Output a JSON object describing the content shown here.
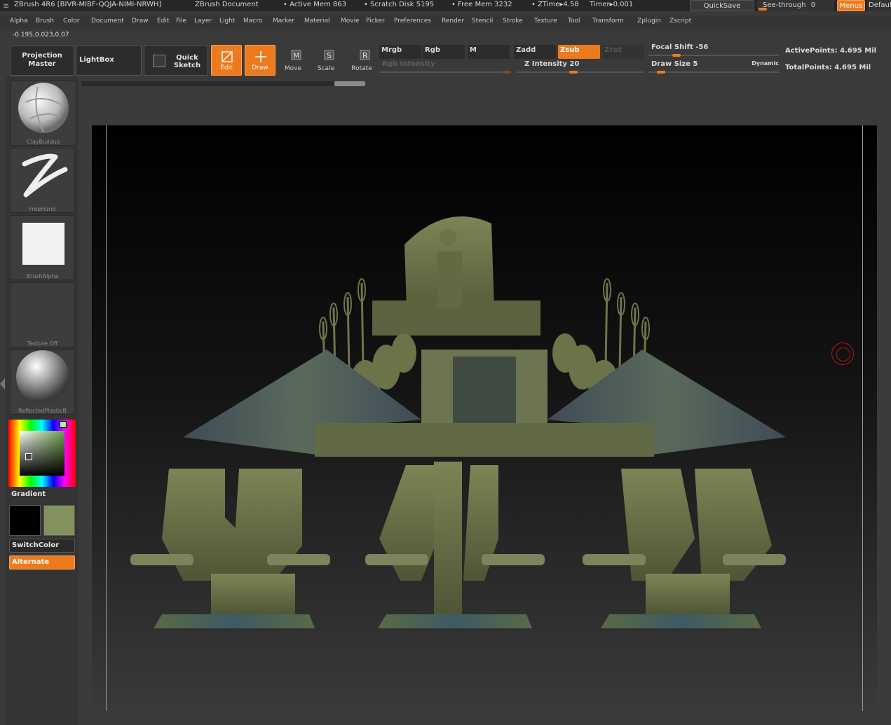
{
  "title_bar": {
    "app": "ZBrush 4R6 [BIVR-MIBF-QQJA-NIMI-NRWH]",
    "document": "ZBrush Document",
    "active_mem": "• Active Mem 863",
    "scratch_disk": "• Scratch Disk 5195",
    "free_mem": "• Free Mem 3232",
    "ztime": "• ZTime▸4.58",
    "timer": "Timer▸0.001",
    "quicksave": "QuickSave",
    "see_through": "See-through",
    "see_through_value": "0",
    "menus": "Menus",
    "default": "Default"
  },
  "menu": [
    "Alpha",
    "Brush",
    "Color",
    "Document",
    "Draw",
    "Edit",
    "File",
    "Layer",
    "Light",
    "Macro",
    "Marker",
    "Material",
    "Movie",
    "Picker",
    "Preferences",
    "Render",
    "Stencil",
    "Stroke",
    "Texture",
    "Tool",
    "Transform",
    "Zplugin",
    "Zscript"
  ],
  "coords": "-0.195,0.023,0.07",
  "toolbar": {
    "projection_master": "Projection Master",
    "lightbox": "LightBox",
    "quick_sketch": "Quick Sketch",
    "edit": "Edit",
    "draw": "Draw",
    "move": "Move",
    "scale": "Scale",
    "rotate": "Rotate",
    "mrgb": "Mrgb",
    "rgb": "Rgb",
    "m": "M",
    "zadd": "Zadd",
    "zsub": "Zsub",
    "zcut": "Zcut",
    "rgb_intensity": "Rgb Intensity",
    "z_intensity": "Z Intensity 20",
    "focal_shift": "Focal Shift -56",
    "draw_size": "Draw Size 5",
    "dynamic": "Dynamic",
    "active_points": "ActivePoints: 4.695 Mil",
    "total_points": "TotalPoints: 4.695 Mil"
  },
  "left_panel": {
    "brush": "ClayBuildup",
    "stroke": "FreeHand",
    "alpha": "BrushAlpha",
    "texture": "Texture Off",
    "material": "ReflectedPlasticB",
    "gradient": "Gradient",
    "switch_color": "SwitchColor",
    "alternate": "Alternate"
  },
  "colors": {
    "accent": "#ed7b1d",
    "main_color": "#82915d",
    "secondary_color": "#000000",
    "model": "#6b7348"
  },
  "icons": [
    "zbrush-logo-icon",
    "edit-icon",
    "draw-icon",
    "move-icon",
    "scale-icon",
    "rotate-icon",
    "quick-sketch-icon",
    "brush-cursor-icon"
  ],
  "canvas": {
    "description": "3D sculpt"
  }
}
